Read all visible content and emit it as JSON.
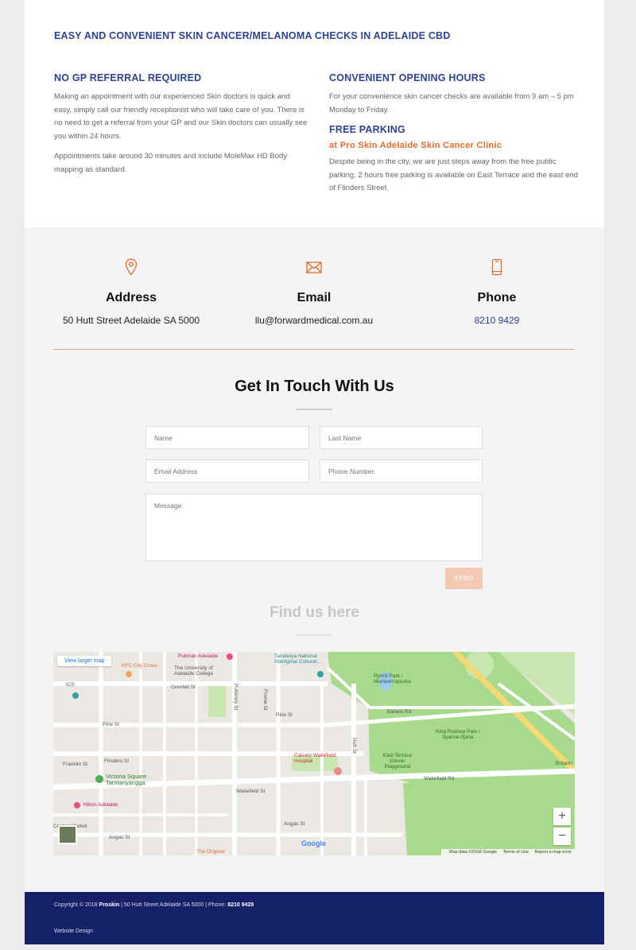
{
  "intro": {
    "heading": "EASY AND CONVENIENT SKIN CANCER/MELANOMA CHECKS IN ADELAIDE CBD",
    "left": {
      "heading": "NO GP REFERRAL REQUIRED",
      "para1": "Making an appointment with our experienced Skin doctors is quick and easy, simply call our friendly receptionist who will take care of you.  There is no need to get a referral from your GP and our Skin doctors can usually see you within 24 hours.",
      "para2": "Appointments take around 30 minutes and include MoleMax HD Body mapping as standard."
    },
    "right": {
      "hours_heading": "CONVENIENT OPENING HOURS",
      "hours_text": "For your convenience skin cancer checks are available from 9 am – 5 pm Monday to Friday.",
      "parking_heading": "FREE PARKING",
      "parking_subheading": "at Pro Skin Adelaide Skin Cancer Clinic",
      "parking_text": "Despite being in the city, we are just steps away from the free public parking.  2 hours free parking is available on East Terrace and the east end of Flinders Street."
    }
  },
  "contact": {
    "address_title": "Address",
    "address_value": "50 Hutt Street Adelaide SA 5000",
    "email_title": "Email",
    "email_value": "llu@forwardmedical.com.au",
    "phone_title": "Phone",
    "phone_value": "8210 9429"
  },
  "form": {
    "title": "Get In Touch With Us",
    "name_placeholder": "Name",
    "last_name_placeholder": "Last Name",
    "email_placeholder": "Email Address",
    "phone_placeholder": "Phone Number",
    "message_placeholder": "Message",
    "send_label": "SEND"
  },
  "map": {
    "title": "Find us here",
    "larger_map": "View larger map",
    "zoom_in": "+",
    "zoom_out": "−",
    "google": "Google",
    "map_data": "Map data ©2018 Google",
    "terms": "Terms of Use",
    "report": "Report a map error",
    "labels": {
      "pullman": "Pullman Adelaide",
      "kfc": "KFC City Cross",
      "uni": "The University of Adelaide College",
      "tandanya": "Tandanya National Aboriginal Cultural...",
      "rymill": "Rymill Park / Murlawirrapurka",
      "king_rodney": "King Rodney Park / Ityamai-Itpina",
      "calvary": "Calvary Wakefield Hospital",
      "east_terrace": "East Terrace Glover Playground",
      "victoria": "Victoria Square Tarntanyangga",
      "hilton": "Hilton Adelaide",
      "central_market": "Central Market",
      "ics": "ICS",
      "grenfell": "Grenfell St",
      "pirie_left": "Pirie St",
      "pirie": "Pirie St",
      "flinders_left": "Franklin St",
      "flinders": "Flinders St",
      "wakefield": "Wakefield St",
      "wakefield_rd": "Wakefield Rd",
      "angas": "Angas St",
      "angas_left": "Angas St",
      "bartels": "Bartels Rd",
      "frome": "Frome St",
      "hutt": "Hutt St",
      "pulteney": "Pulteney St",
      "the_original": "The Original",
      "britannia": "Britann"
    }
  },
  "footer": {
    "copyright_prefix": "Copyright © 2018",
    "brand": "Proskin",
    "copyright_middle": "| 50 Hutt Street Adelaide SA 5000 | Phone:",
    "phone": "8210 9429",
    "design": "Website Design"
  },
  "colors": {
    "heading_blue": "#2d4393",
    "accent_orange": "#e36a2b",
    "footer_navy": "#142168",
    "send_button": "#f3c9b4"
  },
  "icons": {
    "address": "map-pin-icon",
    "email": "envelope-icon",
    "phone": "mobile-phone-icon"
  }
}
